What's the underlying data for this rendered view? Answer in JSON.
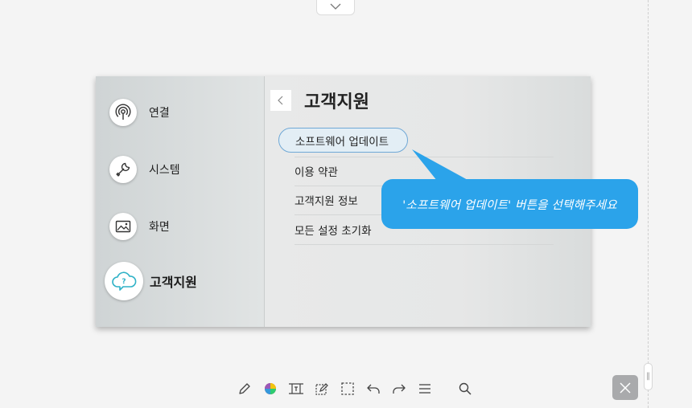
{
  "window": {
    "collapse_icon": "chevron-down-icon"
  },
  "sidebar": {
    "items": [
      {
        "label": "연결",
        "icon": "broadcast-icon",
        "active": false
      },
      {
        "label": "시스템",
        "icon": "wrench-icon",
        "active": false
      },
      {
        "label": "화면",
        "icon": "picture-icon",
        "active": false
      },
      {
        "label": "고객지원",
        "icon": "help-cloud-icon",
        "active": true
      }
    ]
  },
  "main": {
    "title": "고객지원",
    "back_icon": "chevron-left-icon",
    "menu": [
      {
        "label": "소프트웨어 업데이트",
        "highlighted": true
      },
      {
        "label": "이용 약관",
        "highlighted": false
      },
      {
        "label": "고객지원 정보",
        "highlighted": false
      },
      {
        "label": "모든 설정 초기화",
        "highlighted": false
      }
    ]
  },
  "callout": {
    "text": "'소프트웨어 업데이트' 버튼을 선택해주세요",
    "color": "#2ba3ea"
  },
  "toolbar": {
    "tools": [
      "pen-icon",
      "color-wheel-icon",
      "text-frame-icon",
      "edit-note-icon",
      "select-rect-icon",
      "undo-icon",
      "redo-icon",
      "menu-icon",
      "search-icon"
    ]
  },
  "close_icon": "close-icon",
  "colors": {
    "accent": "#2ba3ea",
    "highlight_border": "#6fa8d6",
    "close_bg": "#a9aaac"
  }
}
